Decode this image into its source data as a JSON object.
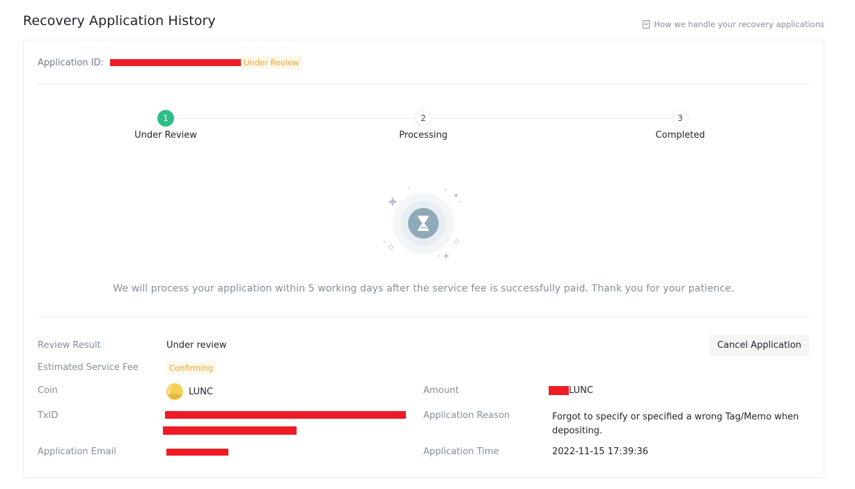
{
  "header": {
    "title": "Recovery Application History",
    "help_link": "How we handle your recovery applications"
  },
  "application": {
    "id_label": "Application ID",
    "id_colon": ":",
    "status": "Under Review"
  },
  "steps": [
    {
      "number": "1",
      "label": "Under Review",
      "active": true
    },
    {
      "number": "2",
      "label": "Processing",
      "active": false
    },
    {
      "number": "3",
      "label": "Completed",
      "active": false
    }
  ],
  "notice": "We will process your application within 5 working days after the service fee is successfully paid. Thank you for your patience.",
  "details": {
    "review_result_label": "Review Result",
    "review_result_value": "Under review",
    "service_fee_label": "Estimated Service Fee",
    "service_fee_value": "Confirming",
    "coin_label": "Coin",
    "coin_value": "LUNC",
    "amount_label": "Amount",
    "amount_unit": "LUNC",
    "txid_label": "TxID",
    "reason_label": "Application Reason",
    "reason_value_line1": "Forgot to specify or specified a wrong Tag/Memo when",
    "reason_value_line2": "depositing.",
    "email_label": "Application Email",
    "time_label": "Application Time",
    "time_value": "2022-11-15 17:39:36"
  },
  "actions": {
    "cancel_label": "Cancel Application"
  },
  "colors": {
    "active_step": "#2ebd85",
    "status_tag_text": "#f3a33b",
    "redaction": "#ee1c25",
    "coin_icon": "#f6cf57"
  }
}
